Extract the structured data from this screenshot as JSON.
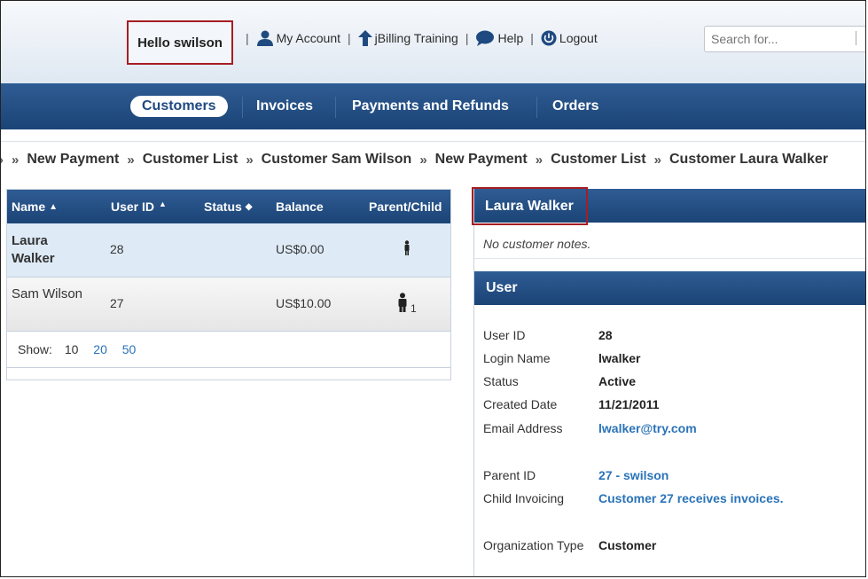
{
  "header": {
    "greeting": "Hello swilson",
    "links": {
      "my_account": "My Account",
      "training": "jBilling Training",
      "help": "Help",
      "logout": "Logout"
    },
    "search_placeholder": "Search for..."
  },
  "nav": {
    "tabs": [
      "Customers",
      "Invoices",
      "Payments and Refunds",
      "Orders"
    ],
    "active": "Customers"
  },
  "breadcrumbs": [
    "New Payment",
    "Customer List",
    "Customer Sam Wilson",
    "New Payment",
    "Customer List",
    "Customer Laura Walker"
  ],
  "table": {
    "headers": {
      "name": "Name",
      "user_id": "User ID",
      "status": "Status",
      "balance": "Balance",
      "parent_child": "Parent/Child"
    },
    "rows": [
      {
        "name": "Laura Walker",
        "user_id": "28",
        "status": "",
        "balance": "US$0.00",
        "child_count": ""
      },
      {
        "name": "Sam Wilson",
        "user_id": "27",
        "status": "",
        "balance": "US$10.00",
        "child_count": "1"
      }
    ],
    "show": {
      "label": "Show:",
      "options": [
        "10",
        "20",
        "50"
      ],
      "current": "10"
    }
  },
  "customer": {
    "name": "Laura Walker",
    "notes": "No customer notes.",
    "user_section": "User",
    "fields": {
      "user_id": {
        "label": "User ID",
        "value": "28"
      },
      "login_name": {
        "label": "Login Name",
        "value": "lwalker"
      },
      "status": {
        "label": "Status",
        "value": "Active"
      },
      "created_date": {
        "label": "Created Date",
        "value": "11/21/2011"
      },
      "email": {
        "label": "Email Address",
        "value": "lwalker@try.com"
      },
      "parent_id": {
        "label": "Parent ID",
        "value": "27 - swilson"
      },
      "child_invoicing": {
        "label": "Child Invoicing",
        "value": "Customer 27 receives invoices."
      },
      "org_type": {
        "label": "Organization Type",
        "value": "Customer"
      }
    }
  },
  "colors": {
    "nav_blue": "#1f4a80",
    "link_blue": "#2a73b8",
    "highlight_red": "#a61d24",
    "selected_row": "#deebf7"
  }
}
